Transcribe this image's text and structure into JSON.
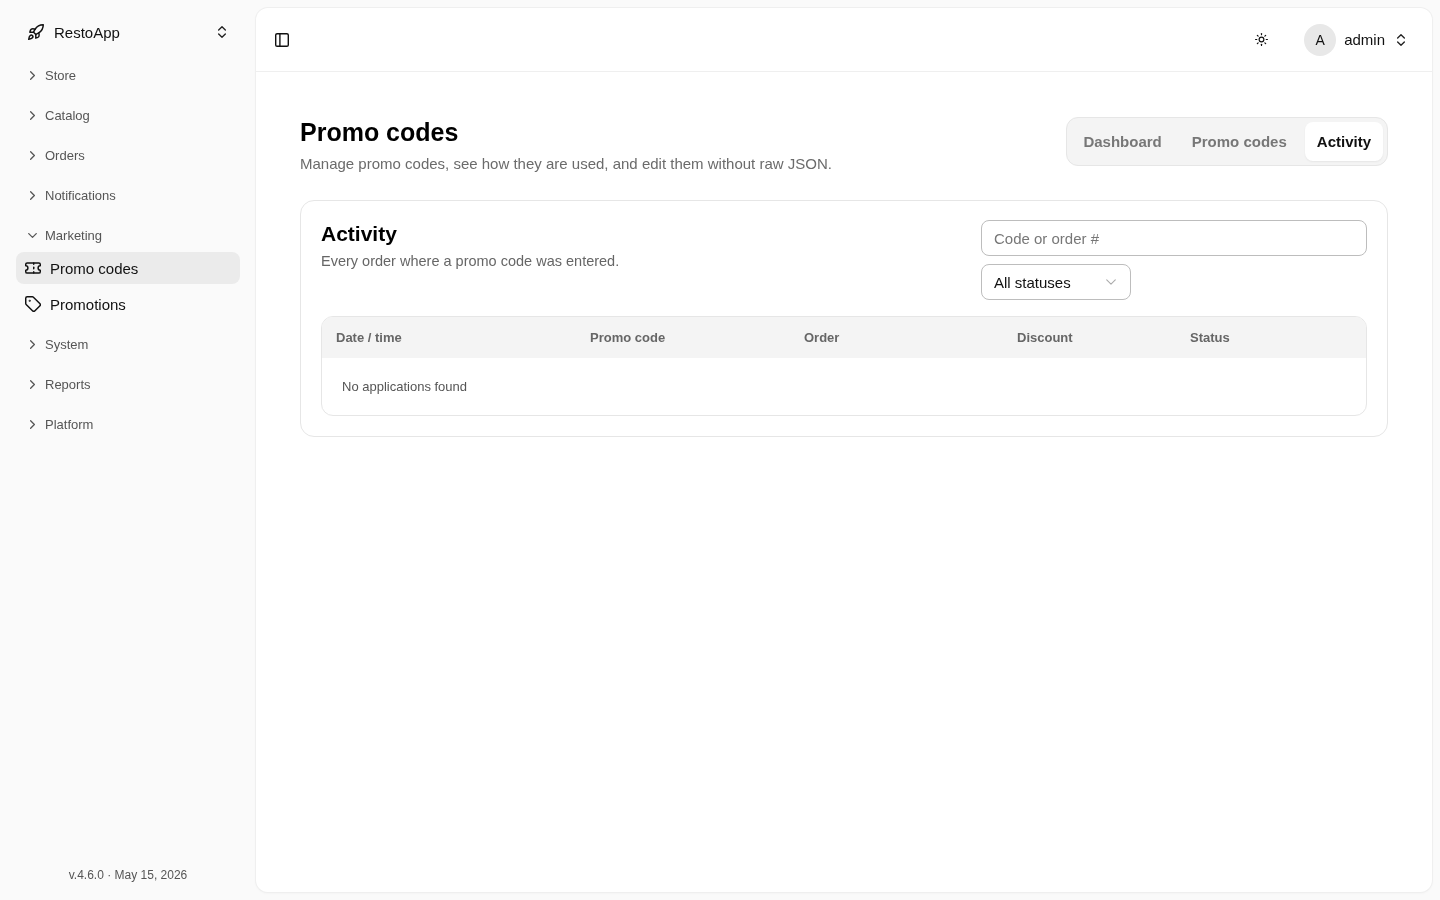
{
  "sidebar": {
    "brand": "RestoApp",
    "nav": [
      {
        "label": "Store",
        "expanded": false
      },
      {
        "label": "Catalog",
        "expanded": false
      },
      {
        "label": "Orders",
        "expanded": false
      },
      {
        "label": "Notifications",
        "expanded": false
      },
      {
        "label": "Marketing",
        "expanded": true,
        "children": [
          {
            "label": "Promo codes",
            "selected": true
          },
          {
            "label": "Promotions",
            "selected": false
          }
        ]
      },
      {
        "label": "System",
        "expanded": false
      },
      {
        "label": "Reports",
        "expanded": false
      },
      {
        "label": "Platform",
        "expanded": false
      }
    ],
    "footer": "v.4.6.0 · May 15, 2026"
  },
  "topbar": {
    "avatar_initial": "A",
    "user": "admin"
  },
  "page": {
    "title": "Promo codes",
    "subtitle": "Manage promo codes, see how they are used, and edit them without raw JSON.",
    "tabs": [
      {
        "label": "Dashboard",
        "selected": false
      },
      {
        "label": "Promo codes",
        "selected": false
      },
      {
        "label": "Activity",
        "selected": true
      }
    ]
  },
  "activity": {
    "title": "Activity",
    "description": "Every order where a promo code was entered.",
    "search": {
      "placeholder": "Code or order #"
    },
    "status_filter": {
      "value": "All statuses"
    },
    "table": {
      "columns": [
        "Date / time",
        "Promo code",
        "Order",
        "Discount",
        "Status"
      ],
      "empty_message": "No applications found"
    }
  }
}
